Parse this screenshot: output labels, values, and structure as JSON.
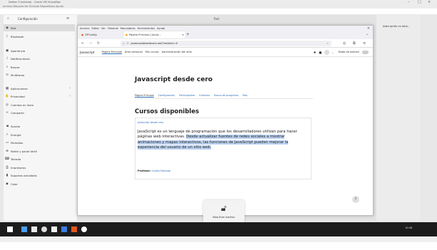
{
  "host": {
    "title": "Debian 9 (estonia) - Oracle VM VirtualBox",
    "menu": "Archivo   Máquina   Ver   Entrada   Dispositivos   Ayuda",
    "controls": [
      "–",
      "□",
      "×"
    ]
  },
  "settings": {
    "search_icon": "search-icon",
    "title": "Configuración",
    "items": [
      {
        "label": "Red",
        "icon": "wifi-icon"
      },
      {
        "label": "Bluetooth",
        "icon": "bluetooth-icon"
      },
      {
        "label": "Apariencia",
        "icon": "appearance-icon"
      },
      {
        "label": "Notificaciones",
        "icon": "bell-icon"
      },
      {
        "label": "Buscar",
        "icon": "search-icon"
      },
      {
        "label": "Multitarea",
        "icon": "multitask-icon"
      },
      {
        "label": "Aplicaciones",
        "icon": "apps-icon"
      },
      {
        "label": "Privacidad",
        "icon": "privacy-icon"
      },
      {
        "label": "Cuentas en línea",
        "icon": "accounts-icon"
      },
      {
        "label": "Compartir",
        "icon": "share-icon"
      },
      {
        "label": "Sonido",
        "icon": "sound-icon"
      },
      {
        "label": "Energía",
        "icon": "power-icon"
      },
      {
        "label": "Pantallas",
        "icon": "display-icon"
      },
      {
        "label": "Ratón y panel táctil",
        "icon": "mouse-icon"
      },
      {
        "label": "Teclado",
        "icon": "keyboard-icon"
      },
      {
        "label": "Impresoras",
        "icon": "printer-icon"
      },
      {
        "label": "Soportes extraíbles",
        "icon": "usb-icon"
      },
      {
        "label": "Color",
        "icon": "color-icon"
      }
    ]
  },
  "gnome": {
    "window_title": "Red",
    "notification": "Adscripción no total..."
  },
  "firefox": {
    "menu": [
      "Archivo",
      "Editar",
      "Ver",
      "Historial",
      "Marcadores",
      "Herramientas",
      "Ayuda"
    ],
    "tabs": [
      {
        "label": "GPConfig"
      },
      {
        "label": "Página Principal | Javas..."
      }
    ],
    "url": "javascriptdesdecero.net/?redirect=0",
    "site_nav": {
      "brand": "Javascript",
      "links": [
        "Página Principal",
        "Área personal",
        "Mis cursos",
        "Administración del sitio"
      ],
      "edit_mode": "Modo de edición"
    }
  },
  "page": {
    "course_title": "Javascript desde cero",
    "tabs": [
      "Página Principal",
      "Configuración",
      "Participantes",
      "Informes",
      "Banco de preguntas",
      "Más"
    ],
    "section_title": "Cursos disponibles",
    "card": {
      "link": "javascript desde cero",
      "text_plain": "JavaScript es un lenguaje de programación que los desarrolladores utilizan para hacer páginas web interactivas. ",
      "text_highlight": "Desde actualizar fuentes de redes sociales a mostrar animaciones y mapas interactivos, las funciones de JavaScript pueden mejorar la experiencia del usuario de un sitio web.",
      "professor_label": "Profesor:",
      "professor_name": "Carlos Baraujo"
    },
    "help": "?"
  },
  "osd": {
    "icon": "lock-icon",
    "text": "Bloq Num inactivo"
  },
  "taskbar": {
    "clock": "10:48"
  }
}
